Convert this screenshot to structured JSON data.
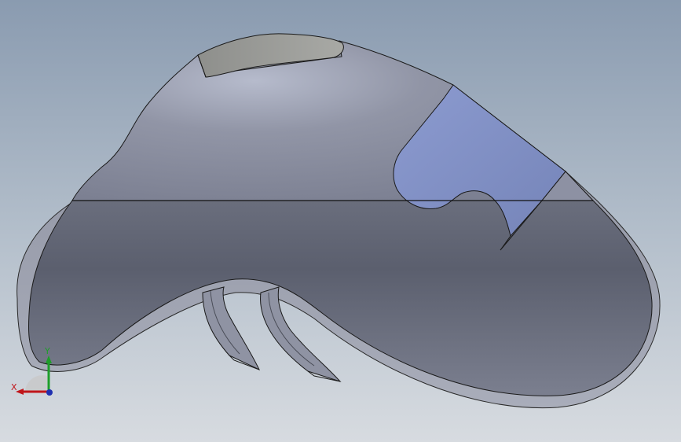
{
  "viewport": {
    "background_top": "#8a9bb0",
    "background_bottom": "#d7dbe0"
  },
  "model": {
    "body_color": "#7f8394",
    "selected_face_color": "#7f8fbf",
    "edge_color": "#1a1a1a"
  },
  "triad": {
    "x_label": "X",
    "y_label": "Y",
    "x_color": "#c0151a",
    "y_color": "#1e9e2a",
    "z_color": "#1f2fb0"
  }
}
